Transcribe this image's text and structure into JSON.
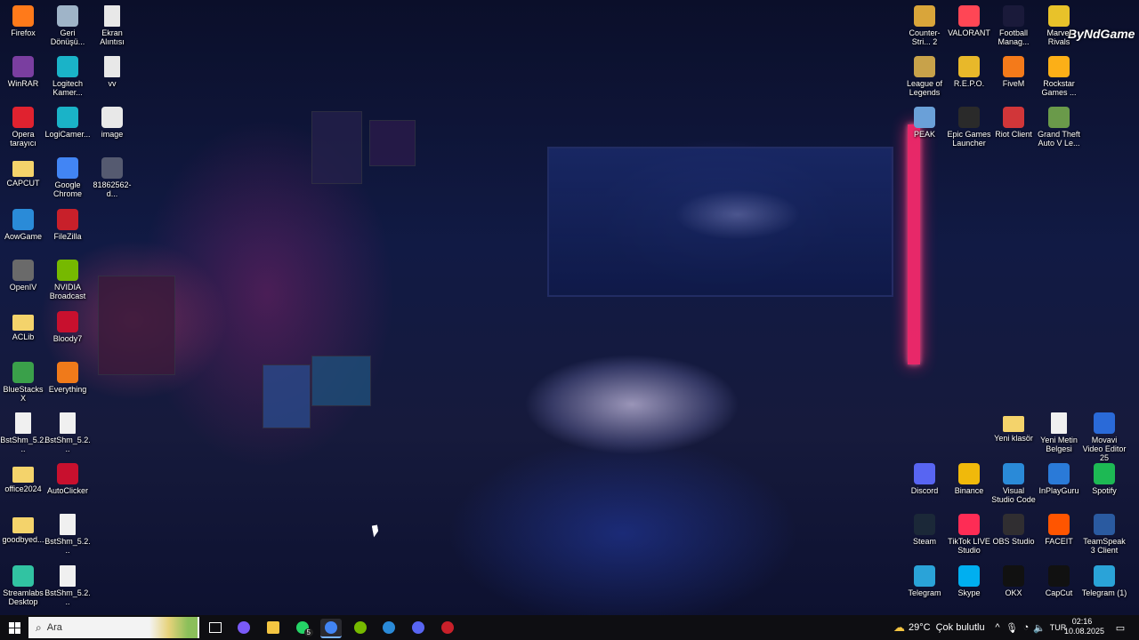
{
  "desktop": {
    "icons": [
      {
        "label": "Firefox",
        "icon": "firefox-icon",
        "color": "#ff7a1a"
      },
      {
        "label": "Geri Dönüşü...",
        "icon": "recycle-bin-icon",
        "color": "#9fb4c8"
      },
      {
        "label": "Ekran Alıntısı",
        "icon": "file-icon",
        "color": "#e8e8e8"
      },
      {
        "label": "WinRAR",
        "icon": "winrar-icon",
        "color": "#7a3ea0"
      },
      {
        "label": "Logitech Kamer...",
        "icon": "logitech-icon",
        "color": "#1ab3c8"
      },
      {
        "label": "vv",
        "icon": "file-icon",
        "color": "#e8e8e8"
      },
      {
        "label": "Opera tarayıcı",
        "icon": "opera-icon",
        "color": "#e0222f"
      },
      {
        "label": "LogiCamer...",
        "icon": "logitech-icon",
        "color": "#1ab3c8"
      },
      {
        "label": "image",
        "icon": "image-file-icon",
        "color": "#e8e8e8"
      },
      {
        "label": "CAPCUT",
        "icon": "folder-icon",
        "color": "#f4d36b"
      },
      {
        "label": "Google Chrome",
        "icon": "chrome-icon",
        "color": "#4285f4"
      },
      {
        "label": "81862562-d...",
        "icon": "image-file-icon",
        "color": "#555a70"
      },
      {
        "label": "AowGame",
        "icon": "edge-icon",
        "color": "#2a8bd8"
      },
      {
        "label": "FileZilla",
        "icon": "filezilla-icon",
        "color": "#c8202a"
      },
      {
        "label": "OpenIV",
        "icon": "openiv-icon",
        "color": "#6a6a6a"
      },
      {
        "label": "NVIDIA Broadcast",
        "icon": "nvidia-icon",
        "color": "#76b900"
      },
      {
        "label": "ACLib",
        "icon": "folder-icon",
        "color": "#f4d36b"
      },
      {
        "label": "Bloody7",
        "icon": "bloody-icon",
        "color": "#c8102e"
      },
      {
        "label": "BlueStacks X",
        "icon": "bluestacks-icon",
        "color": "#3aa04a"
      },
      {
        "label": "Everything",
        "icon": "everything-icon",
        "color": "#f07a1a"
      },
      {
        "label": "BstShm_5.2...",
        "icon": "file-icon",
        "color": "#f0f0f0"
      },
      {
        "label": "BstShm_5.2...",
        "icon": "file-icon",
        "color": "#f0f0f0"
      },
      {
        "label": "office2024",
        "icon": "folder-icon",
        "color": "#f4d36b"
      },
      {
        "label": "AutoClicker",
        "icon": "autoclicker-icon",
        "color": "#c8102e"
      },
      {
        "label": "goodbyed...",
        "icon": "folder-icon",
        "color": "#f4d36b"
      },
      {
        "label": "BstShm_5.2...",
        "icon": "file-icon",
        "color": "#f0f0f0"
      },
      {
        "label": "Streamlabs Desktop",
        "icon": "streamlabs-icon",
        "color": "#31c3a2"
      },
      {
        "label": "BstShm_5.2...",
        "icon": "file-icon",
        "color": "#f0f0f0"
      },
      {
        "label": "Counter-Stri... 2",
        "icon": "counter-strike-icon",
        "color": "#d9a53a"
      },
      {
        "label": "VALORANT",
        "icon": "valorant-icon",
        "color": "#ff4655"
      },
      {
        "label": "Football Manag...",
        "icon": "football-manager-icon",
        "color": "#1a1a3a"
      },
      {
        "label": "Marvel Rivals",
        "icon": "marvel-rivals-icon",
        "color": "#e8c22a"
      },
      {
        "label": "League of Legends",
        "icon": "league-icon",
        "color": "#c8a24a"
      },
      {
        "label": "R.E.P.O.",
        "icon": "repo-icon",
        "color": "#e8b82a"
      },
      {
        "label": "FiveM",
        "icon": "fivem-icon",
        "color": "#f47a1a"
      },
      {
        "label": "Rockstar Games ...",
        "icon": "rockstar-icon",
        "color": "#fcaf17"
      },
      {
        "label": "PEAK",
        "icon": "peak-icon",
        "color": "#6aa0d8"
      },
      {
        "label": "Epic Games Launcher",
        "icon": "epic-games-icon",
        "color": "#2a2a2a"
      },
      {
        "label": "Riot Client",
        "icon": "riot-icon",
        "color": "#d13639"
      },
      {
        "label": "Grand Theft Auto V Le...",
        "icon": "gta-icon",
        "color": "#6a9a4a"
      },
      {
        "label": "Yeni klasör",
        "icon": "folder-icon",
        "color": "#f4d36b"
      },
      {
        "label": "Yeni Metin Belgesi",
        "icon": "text-file-icon",
        "color": "#f0f0f0"
      },
      {
        "label": "Movavi Video Editor 25",
        "icon": "movavi-icon",
        "color": "#2a6ad8"
      },
      {
        "label": "Discord",
        "icon": "discord-icon",
        "color": "#5865f2"
      },
      {
        "label": "Binance",
        "icon": "binance-icon",
        "color": "#f0b90b"
      },
      {
        "label": "Visual Studio Code",
        "icon": "vscode-icon",
        "color": "#2a8ad8"
      },
      {
        "label": "InPlayGuru",
        "icon": "inplayguru-icon",
        "color": "#2a7ad8"
      },
      {
        "label": "Spotify",
        "icon": "spotify-icon",
        "color": "#1db954"
      },
      {
        "label": "Steam",
        "icon": "steam-icon",
        "color": "#1b2838"
      },
      {
        "label": "TikTok LIVE Studio",
        "icon": "tiktok-icon",
        "color": "#fe2c55"
      },
      {
        "label": "OBS Studio",
        "icon": "obs-icon",
        "color": "#302e31"
      },
      {
        "label": "FACEIT",
        "icon": "faceit-icon",
        "color": "#ff5500"
      },
      {
        "label": "TeamSpeak 3 Client",
        "icon": "teamspeak-icon",
        "color": "#2a5aa0"
      },
      {
        "label": "Telegram",
        "icon": "telegram-icon",
        "color": "#2aa3d8"
      },
      {
        "label": "Skype",
        "icon": "skype-icon",
        "color": "#00aff0"
      },
      {
        "label": "OKX",
        "icon": "okx-icon",
        "color": "#111111"
      },
      {
        "label": "CapCut",
        "icon": "capcut-icon",
        "color": "#111111"
      },
      {
        "label": "Telegram (1)",
        "icon": "telegram-icon",
        "color": "#2aa3d8"
      }
    ],
    "watermark": "ByNdGame"
  },
  "taskbar": {
    "search_placeholder": "Ara",
    "pinned": [
      {
        "name": "task-view",
        "icon": "task-view-icon",
        "color": "#ffffff"
      },
      {
        "name": "copilot",
        "icon": "copilot-icon",
        "color": "#7a5af8"
      },
      {
        "name": "file-explorer",
        "icon": "folder-icon",
        "color": "#f4c542"
      },
      {
        "name": "whatsapp",
        "icon": "whatsapp-icon",
        "color": "#25d366",
        "badge": "5"
      },
      {
        "name": "chrome",
        "icon": "chrome-icon",
        "color": "#4285f4"
      },
      {
        "name": "nvidia",
        "icon": "nvidia-icon",
        "color": "#76b900"
      },
      {
        "name": "vscode",
        "icon": "vscode-icon",
        "color": "#2a8ad8"
      },
      {
        "name": "discord",
        "icon": "discord-icon",
        "color": "#5865f2"
      },
      {
        "name": "app",
        "icon": "app-icon",
        "color": "#c8202a"
      }
    ],
    "weather": {
      "temp": "29°C",
      "desc": "Çok bulutlu"
    },
    "lang": "TUR",
    "time": "02:16",
    "date": "10.08.2025"
  }
}
